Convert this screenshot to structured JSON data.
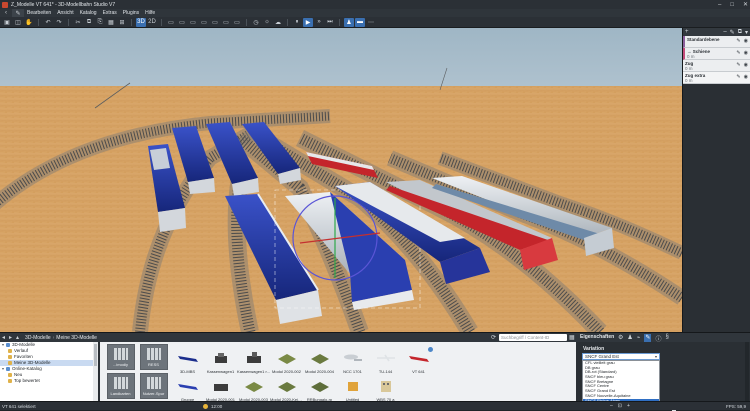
{
  "window": {
    "title": "Z_Modelle VT 641* - 3D-Modellbahn Studio V7",
    "controls": [
      "–",
      "□",
      "✕"
    ]
  },
  "menu": {
    "items": [
      "Bearbeiten",
      "Ansicht",
      "Katalog",
      "Extras",
      "Plugins",
      "Hilfe"
    ]
  },
  "toolbar": {
    "buttons": [
      {
        "name": "save-icon",
        "glyph": "▣"
      },
      {
        "name": "undo-icon",
        "glyph": "↶"
      },
      {
        "name": "redo-icon",
        "glyph": "↷"
      },
      {
        "name": "cut-icon",
        "glyph": "✂"
      },
      {
        "name": "copy-icon",
        "glyph": "⧉"
      },
      {
        "name": "paste-icon",
        "glyph": "⎘"
      },
      {
        "name": "view-3d-icon",
        "glyph": "3D"
      },
      {
        "name": "view-2d-icon",
        "glyph": "2D"
      },
      {
        "name": "play-icon",
        "glyph": "▶"
      },
      {
        "name": "pause-icon",
        "glyph": "⏸"
      }
    ]
  },
  "layers_panel": {
    "header_icons": [
      "+",
      "–",
      "✎",
      "⧉",
      "▾"
    ],
    "layers": [
      {
        "name": "Standardebene",
        "value": "",
        "kind": "first"
      },
      {
        "name": "Schiene",
        "value": "0 m",
        "kind": "sel"
      },
      {
        "name": "Zug",
        "value": "0 m",
        "kind": ""
      },
      {
        "name": "Zug extra",
        "value": "0 m",
        "kind": "alt"
      }
    ]
  },
  "bottom_panel": {
    "breadcrumb": [
      "3D-Modelle",
      "Meine 3D-Modelle"
    ],
    "search_placeholder": "Suchbegriff / Content-ID",
    "properties_title": "Eigenschaften"
  },
  "tree": {
    "items": [
      {
        "label": "3D-Modelle",
        "indent": 0,
        "exp": "▾",
        "icon": "blue",
        "sel": false
      },
      {
        "label": "Verlauf",
        "indent": 1,
        "exp": "",
        "icon": "",
        "sel": false
      },
      {
        "label": "Favoriten",
        "indent": 1,
        "exp": "",
        "icon": "",
        "sel": false
      },
      {
        "label": "Meine 3D-Modelle",
        "indent": 1,
        "exp": "",
        "icon": "",
        "sel": true
      },
      {
        "label": "Online-Katalog",
        "indent": 0,
        "exp": "▾",
        "icon": "blue",
        "sel": false
      },
      {
        "label": "Neu",
        "indent": 1,
        "exp": "",
        "icon": "",
        "sel": false
      },
      {
        "label": "Top bewertet",
        "indent": 1,
        "exp": "",
        "icon": "",
        "sel": false
      }
    ]
  },
  "catalog": {
    "row1": [
      {
        "label": "...imodiy",
        "kind": "tile"
      },
      {
        "label": "RESS",
        "kind": "tile"
      },
      {
        "label": "3D-MBS",
        "kind": "train-blue"
      },
      {
        "label": "Kassenwagen1",
        "kind": "crane"
      },
      {
        "label": "Kassenwagen1 r...",
        "kind": "crane"
      },
      {
        "label": "Modul 2020-002",
        "kind": "module"
      },
      {
        "label": "Modul 2020-004",
        "kind": "module"
      },
      {
        "label": "NCC 1701",
        "kind": "ship"
      },
      {
        "label": "TU-144",
        "kind": "plane"
      },
      {
        "label": "VT 641",
        "kind": "train-red"
      }
    ],
    "row2": [
      {
        "label": "Landkarten",
        "kind": "tile"
      },
      {
        "label": "Nutzer-Spur",
        "kind": "tile"
      },
      {
        "label": "Gruppe",
        "kind": "train-blue"
      },
      {
        "label": "Modul 2020-001",
        "kind": "crane"
      },
      {
        "label": "Modul 2020-003",
        "kind": "module"
      },
      {
        "label": "Modul 2020-Kein...",
        "kind": "module"
      },
      {
        "label": "RRBungalo-rp",
        "kind": "module"
      },
      {
        "label": "Untitled",
        "kind": "box"
      },
      {
        "label": "WBS 70 a",
        "kind": "building"
      }
    ]
  },
  "properties": {
    "variation_label": "Variation",
    "selected": "SNCF Grand Est",
    "options": [
      "CFL vieilleit grau",
      "DB grau",
      "DB-rot (Standard)",
      "SNCF bleu grau",
      "SNCF Bretagne",
      "SNCF Centre",
      "SNCF Grand Est",
      "SNCF Nouvelle-Aquitaine",
      "SNCF Rhône-Alpes"
    ],
    "highlighted": "SNCF Rhône-Alpes"
  },
  "status": {
    "left": "VT 641 selektiert",
    "time": "12:00",
    "fps": "FPS: 59,9"
  },
  "colors": {
    "accent": "#3a6fb0",
    "sand": "#d9a86a",
    "sky_top": "#9fb6c5",
    "train_blue": "#1b2e8c",
    "train_red": "#c4252b"
  }
}
